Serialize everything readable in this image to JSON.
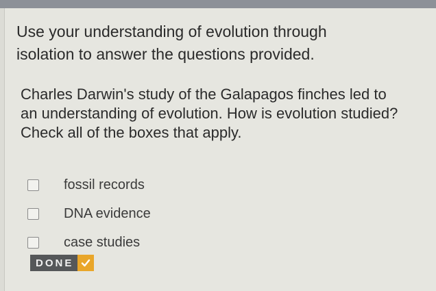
{
  "instructions": {
    "text": "Use your understanding of evolution through isolation to answer the questions provided."
  },
  "question": {
    "text": "Charles Darwin's study of the Galapagos finches led to an understanding of evolution. How is evolution studied? Check all of the boxes that apply."
  },
  "options": [
    {
      "label": "fossil records",
      "checked": false
    },
    {
      "label": "DNA evidence",
      "checked": false
    },
    {
      "label": "case studies",
      "checked": false
    }
  ],
  "done_button": {
    "label": "DONE",
    "icon": "check-icon"
  },
  "colors": {
    "accent": "#e9a62a",
    "button_bg": "#555759",
    "page_bg": "#e6e6e0"
  }
}
